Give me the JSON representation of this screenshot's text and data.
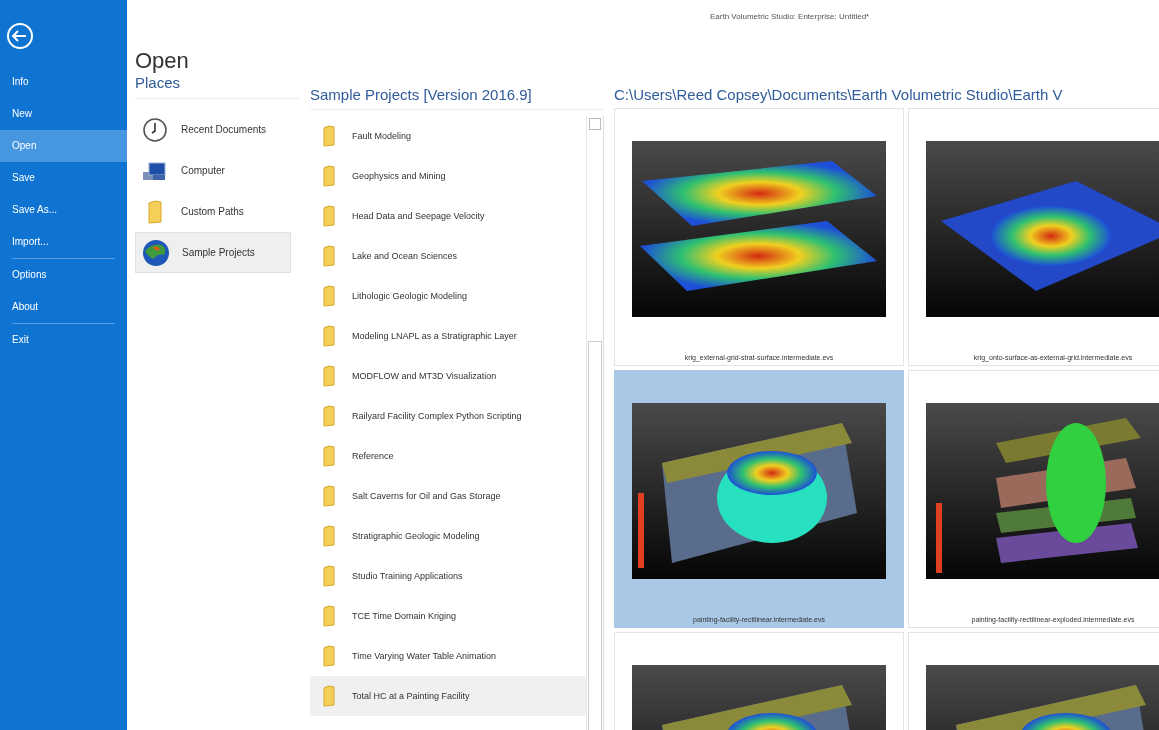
{
  "window": {
    "title": "Earth Volumetric Studio: Enterprise: Untitled*"
  },
  "sidebar": {
    "items": [
      {
        "label": "Info",
        "selected": false,
        "divider_after": false
      },
      {
        "label": "New",
        "selected": false,
        "divider_after": false
      },
      {
        "label": "Open",
        "selected": true,
        "divider_after": false
      },
      {
        "label": "Save",
        "selected": false,
        "divider_after": false
      },
      {
        "label": "Save As...",
        "selected": false,
        "divider_after": false
      },
      {
        "label": "Import...",
        "selected": false,
        "divider_after": true
      },
      {
        "label": "Options",
        "selected": false,
        "divider_after": false
      },
      {
        "label": "About",
        "selected": false,
        "divider_after": true
      },
      {
        "label": "Exit",
        "selected": false,
        "divider_after": false
      }
    ]
  },
  "page_title": "Open",
  "places": {
    "heading": "Places",
    "items": [
      {
        "label": "Recent Documents",
        "kind": "clock",
        "selected": false
      },
      {
        "label": "Computer",
        "kind": "computer",
        "selected": false
      },
      {
        "label": "Custom Paths",
        "kind": "folder",
        "selected": false
      },
      {
        "label": "Sample Projects",
        "kind": "globe",
        "selected": true
      }
    ]
  },
  "projects": {
    "heading": "Sample Projects [Version 2016.9]",
    "items": [
      {
        "label": "Fault Modeling",
        "selected": false
      },
      {
        "label": "Geophysics and Mining",
        "selected": false
      },
      {
        "label": "Head Data and Seepage Velocity",
        "selected": false
      },
      {
        "label": "Lake and Ocean Sciences",
        "selected": false
      },
      {
        "label": "Lithologic Geologic Modeling",
        "selected": false
      },
      {
        "label": "Modeling LNAPL as a Stratigraphic Layer",
        "selected": false
      },
      {
        "label": "MODFLOW and MT3D Visualization",
        "selected": false
      },
      {
        "label": "Railyard Facility Complex Python Scripting",
        "selected": false
      },
      {
        "label": "Reference",
        "selected": false
      },
      {
        "label": "Salt Caverns for Oil and Gas Storage",
        "selected": false
      },
      {
        "label": "Stratigraphic Geologic Modeling",
        "selected": false
      },
      {
        "label": "Studio Training Applications",
        "selected": false
      },
      {
        "label": "TCE Time Domain Kriging",
        "selected": false
      },
      {
        "label": "Time Varying Water Table Animation",
        "selected": false
      },
      {
        "label": "Total HC at a Painting Facility",
        "selected": true
      }
    ]
  },
  "files": {
    "path": "C:\\Users\\Reed Copsey\\Documents\\Earth Volumetric Studio\\Earth V",
    "items": [
      {
        "label": "krig_external-grid-strat-surface.intermediate.evs",
        "kind": "layers",
        "selected": false
      },
      {
        "label": "krig_onto-surface-as-external-grid.intermediate.evs",
        "kind": "plane",
        "selected": false
      },
      {
        "label": "painting-facility-rectilinear.intermediate.evs",
        "kind": "block",
        "selected": true
      },
      {
        "label": "painting-facility-rectilinear-exploded.intermediate.evs",
        "kind": "exploded",
        "selected": false
      },
      {
        "kind": "block",
        "selected": false
      },
      {
        "kind": "block",
        "selected": false
      }
    ]
  }
}
